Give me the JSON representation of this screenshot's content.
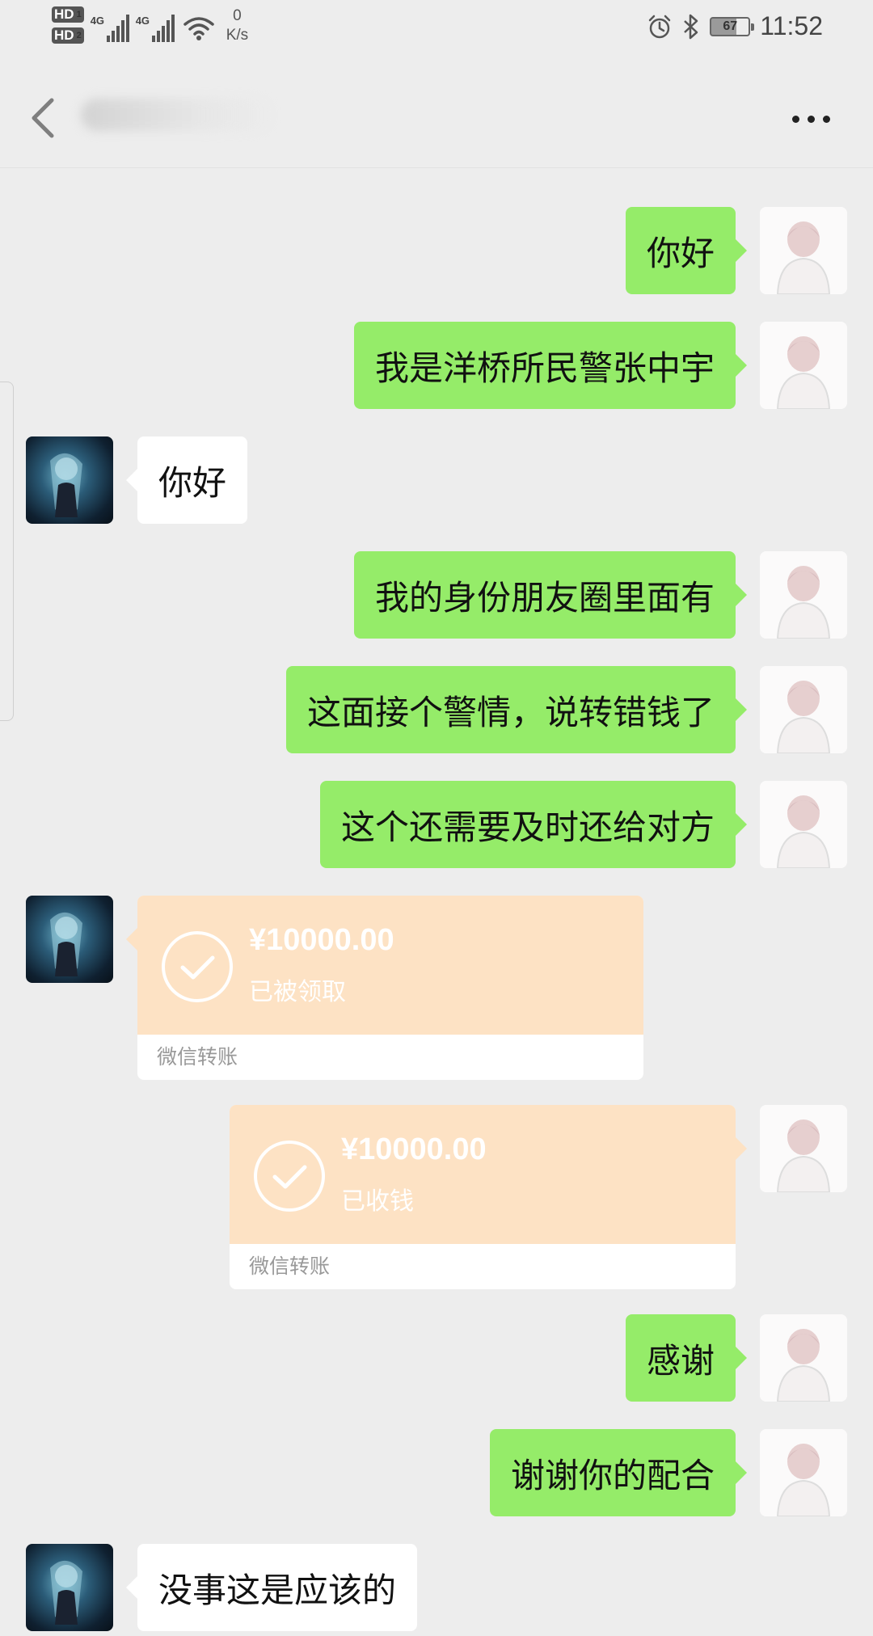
{
  "status_bar": {
    "hd1": "HD",
    "hd1_sub": "1",
    "hd2": "HD",
    "hd2_sub": "2",
    "net1": "4G",
    "net2": "4G",
    "speed_value": "0",
    "speed_unit": "K/s",
    "battery": "67",
    "time": "11:52"
  },
  "icons": {
    "back": "chevron-left-icon",
    "more": "more-dots-icon",
    "alarm": "alarm-icon",
    "bluetooth": "bluetooth-icon",
    "wifi": "wifi-icon",
    "check": "check-circle-icon"
  },
  "colors": {
    "background": "#ededed",
    "my_bubble": "#95ec69",
    "their_bubble": "#ffffff",
    "transfer_card": "#fde2c4",
    "transfer_footer_text": "#999999"
  },
  "messages": [
    {
      "sender": "me",
      "type": "text",
      "text": "你好"
    },
    {
      "sender": "me",
      "type": "text",
      "text": "我是洋桥所民警张中宇"
    },
    {
      "sender": "them",
      "type": "text",
      "text": "你好"
    },
    {
      "sender": "me",
      "type": "text",
      "text": "我的身份朋友圈里面有"
    },
    {
      "sender": "me",
      "type": "text",
      "text": "这面接个警情，说转错钱了"
    },
    {
      "sender": "me",
      "type": "text",
      "text": "这个还需要及时还给对方"
    },
    {
      "sender": "them",
      "type": "transfer",
      "amount": "¥10000.00",
      "status": "已被领取",
      "footer": "微信转账"
    },
    {
      "sender": "me",
      "type": "transfer",
      "amount": "¥10000.00",
      "status": "已收钱",
      "footer": "微信转账"
    },
    {
      "sender": "me",
      "type": "text",
      "text": "感谢"
    },
    {
      "sender": "me",
      "type": "text",
      "text": "谢谢你的配合"
    },
    {
      "sender": "them",
      "type": "text",
      "text": "没事这是应该的"
    }
  ]
}
